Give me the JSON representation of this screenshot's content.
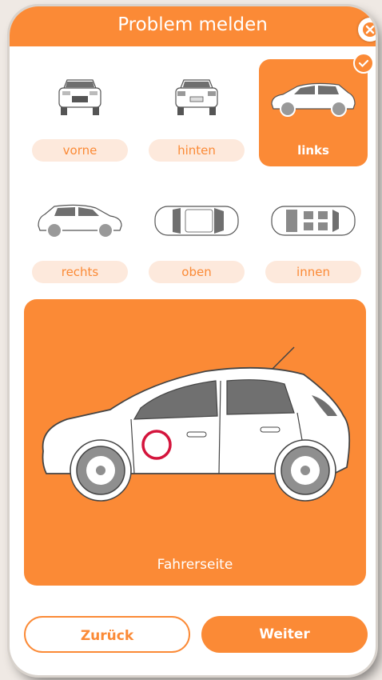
{
  "dialog": {
    "title": "Problem melden"
  },
  "views": [
    {
      "label": "vorne",
      "selected": false
    },
    {
      "label": "hinten",
      "selected": false
    },
    {
      "label": "links",
      "selected": true
    },
    {
      "label": "rechts",
      "selected": false
    },
    {
      "label": "oben",
      "selected": false
    },
    {
      "label": "innen",
      "selected": false
    }
  ],
  "preview": {
    "caption": "Fahrerseite"
  },
  "buttons": {
    "back": "Zurück",
    "next": "Weiter"
  },
  "colors": {
    "accent": "#fb8a36",
    "pill_bg": "#fde9dc",
    "marker": "#d4143c"
  },
  "icons": {
    "close": "close-icon",
    "selected": "check-icon"
  }
}
